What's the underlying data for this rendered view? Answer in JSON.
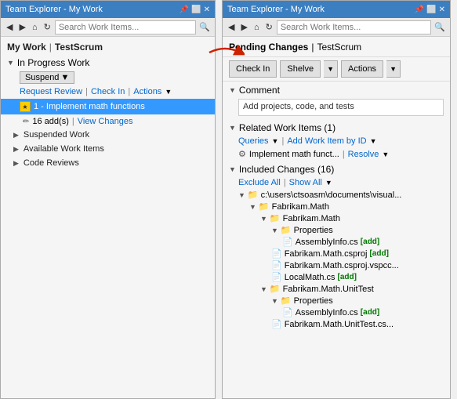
{
  "left": {
    "title": "Team Explorer - My Work",
    "toolbar": {
      "search_placeholder": "Search Work Items..."
    },
    "header": {
      "label": "My Work",
      "pipe": "|",
      "project": "TestScrum"
    },
    "in_progress": {
      "label": "In Progress Work",
      "suspend_label": "Suspend",
      "request_review": "Request Review",
      "check_in": "Check In",
      "actions": "Actions",
      "work_item": "1 - Implement math functions",
      "changes": "16 add(s)",
      "view_changes": "View Changes"
    },
    "suspended": {
      "label": "Suspended Work"
    },
    "available": {
      "label": "Available Work Items"
    },
    "code_reviews": {
      "label": "Code Reviews"
    }
  },
  "right": {
    "title": "Team Explorer - My Work",
    "breadcrumb": {
      "label": "Pending Changes",
      "pipe": "|",
      "project": "TestScrum"
    },
    "toolbar": {
      "check_in": "Check In",
      "shelve": "Shelve",
      "actions": "Actions"
    },
    "comment": {
      "label": "Comment",
      "value": "Add projects, code, and tests"
    },
    "related": {
      "label": "Related Work Items (1)",
      "queries": "Queries",
      "add_work_item": "Add Work Item by ID",
      "work_item": "Implement math funct...",
      "resolve": "Resolve"
    },
    "included": {
      "label": "Included Changes (16)",
      "exclude_all": "Exclude All",
      "show_all": "Show All",
      "path": "c:\\users\\ctsoasm\\documents\\visual...",
      "tree": [
        {
          "indent": 0,
          "type": "folder",
          "name": "Fabrikam.Math"
        },
        {
          "indent": 1,
          "type": "folder",
          "name": "Fabrikam.Math"
        },
        {
          "indent": 2,
          "type": "folder",
          "name": "Properties"
        },
        {
          "indent": 3,
          "type": "file",
          "name": "AssemblyInfo.cs",
          "badge": "[add]"
        },
        {
          "indent": 2,
          "type": "file",
          "name": "Fabrikam.Math.csproj",
          "badge": "[add]"
        },
        {
          "indent": 2,
          "type": "file",
          "name": "Fabrikam.Math.csproj.vspcc...",
          "badge": ""
        },
        {
          "indent": 2,
          "type": "file",
          "name": "LocalMath.cs",
          "badge": "[add]"
        },
        {
          "indent": 1,
          "type": "folder",
          "name": "Fabrikam.Math.UnitTest"
        },
        {
          "indent": 2,
          "type": "folder",
          "name": "Properties"
        },
        {
          "indent": 3,
          "type": "file",
          "name": "AssemblyInfo.cs",
          "badge": "[add]"
        },
        {
          "indent": 2,
          "type": "file",
          "name": "Fabrikam.Math.UnitTest.cs...",
          "badge": ""
        }
      ]
    }
  }
}
